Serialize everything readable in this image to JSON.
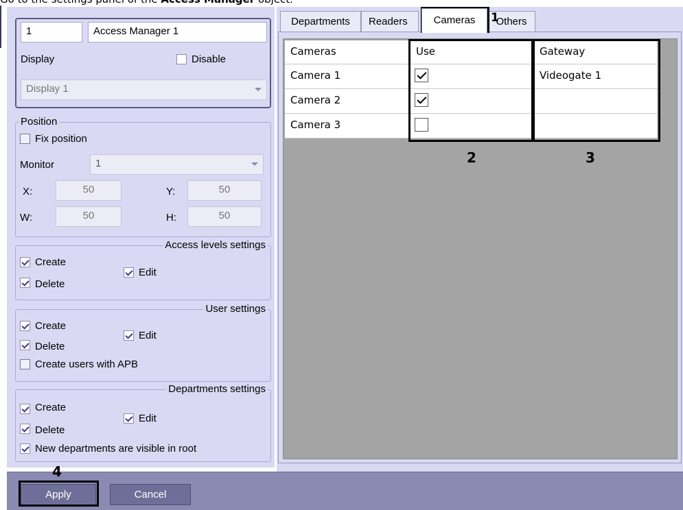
{
  "caption": {
    "prefix": "Go to the settings panel of the ",
    "bold": "Access Manager",
    "suffix": " object."
  },
  "header": {
    "id": "1",
    "name": "Access Manager 1"
  },
  "display": {
    "label": "Display",
    "disable_label": "Disable",
    "value": "Display 1"
  },
  "position": {
    "legend": "Position",
    "fix_label": "Fix position",
    "monitor_label": "Monitor",
    "monitor_value": "1",
    "x_label": "X:",
    "x_value": "50",
    "y_label": "Y:",
    "y_value": "50",
    "w_label": "W:",
    "w_value": "50",
    "h_label": "H:",
    "h_value": "50"
  },
  "access_levels": {
    "legend": "Access levels settings",
    "create": "Create",
    "delete": "Delete",
    "edit": "Edit"
  },
  "user_settings": {
    "legend": "User settings",
    "create": "Create",
    "delete": "Delete",
    "edit": "Edit",
    "apb": "Create users with APB"
  },
  "departments_settings": {
    "legend": "Departments settings",
    "create": "Create",
    "delete": "Delete",
    "edit": "Edit",
    "visible_root": "New departments are visible in root"
  },
  "tabs": [
    "Departments",
    "Readers",
    "Cameras",
    "Others"
  ],
  "grid": {
    "headers": [
      "Cameras",
      "Use",
      "Gateway"
    ],
    "rows": [
      {
        "camera": "Camera 1",
        "use": true,
        "gateway": "Videogate 1"
      },
      {
        "camera": "Camera 2",
        "use": true,
        "gateway": ""
      },
      {
        "camera": "Camera 3",
        "use": false,
        "gateway": ""
      }
    ]
  },
  "annotations": {
    "one": "1",
    "two": "2",
    "three": "3",
    "four": "4"
  },
  "buttons": {
    "apply": "Apply",
    "cancel": "Cancel"
  }
}
